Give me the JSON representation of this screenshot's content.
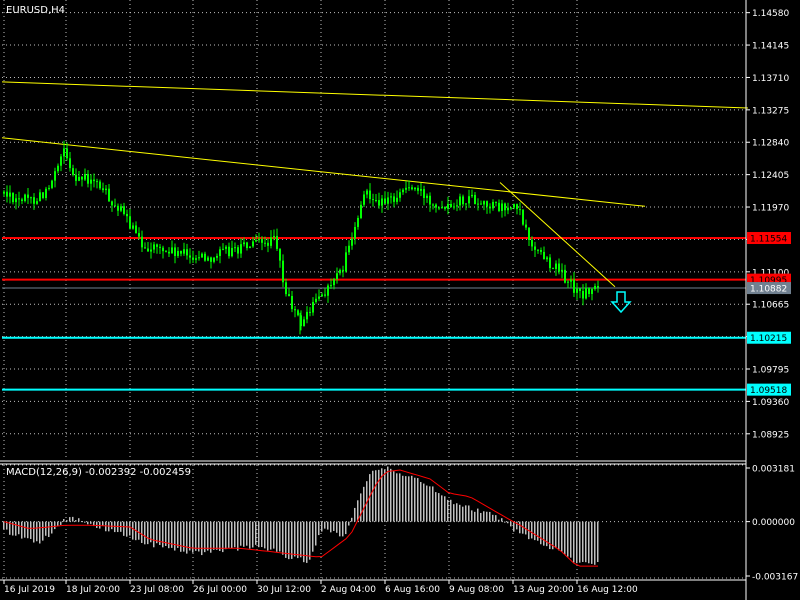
{
  "window": {
    "title": "EURUSD,H4"
  },
  "colors": {
    "background": "#000000",
    "foreground": "#ffffff",
    "grid": "#c0c0c0",
    "candle": "#00ff00",
    "trendline": "#ffff00",
    "resistance": "#ff0000",
    "support": "#00ffff",
    "bid_line": "#708090",
    "macd_hist": "#c0c0c0",
    "macd_signal": "#ff0000"
  },
  "price_axis": {
    "ticks": [
      "1.14580",
      "1.14145",
      "1.13710",
      "1.13275",
      "1.12840",
      "1.12405",
      "1.11970",
      "1.11535",
      "1.11100",
      "1.10665",
      "1.10230",
      "1.09795",
      "1.09360",
      "1.08925"
    ],
    "levels": [
      {
        "label": "1.11554",
        "kind": "resistance"
      },
      {
        "label": "1.10995",
        "kind": "resistance"
      },
      {
        "label": "1.10882",
        "kind": "bid"
      },
      {
        "label": "1.10215",
        "kind": "support"
      },
      {
        "label": "1.09518",
        "kind": "support"
      }
    ]
  },
  "time_axis": {
    "labels": [
      "16 Jul 2019",
      "18 Jul 20:00",
      "23 Jul 08:00",
      "26 Jul 00:00",
      "30 Jul 12:00",
      "2 Aug 04:00",
      "6 Aug 16:00",
      "9 Aug 08:00",
      "13 Aug 20:00",
      "16 Aug 12:00"
    ]
  },
  "macd": {
    "label": "MACD(12,26,9) -0.002392 -0.002459",
    "ticks": [
      "0.003181",
      "0.000000",
      "-0.003167"
    ]
  },
  "chart_data": [
    {
      "type": "candlestick",
      "title": "EURUSD,H4",
      "ylim": [
        1.086,
        1.1475
      ],
      "x": [
        "16 Jul 2019",
        "18 Jul 20:00",
        "23 Jul 08:00",
        "26 Jul 00:00",
        "30 Jul 12:00",
        "2 Aug 04:00",
        "6 Aug 16:00",
        "9 Aug 08:00",
        "13 Aug 20:00",
        "16 Aug 12:00"
      ],
      "close_path": [
        {
          "x": "16 Jul 2019",
          "y": 1.1215
        },
        {
          "x": "18 Jul 20:00",
          "y": 1.1265
        },
        {
          "x": "23 Jul 08:00",
          "y": 1.115
        },
        {
          "x": "26 Jul 00:00",
          "y": 1.113
        },
        {
          "x": "30 Jul 12:00",
          "y": 1.1155
        },
        {
          "x": "2 Aug 04:00",
          "y": 1.1085
        },
        {
          "x": "6 Aug 16:00",
          "y": 1.1205
        },
        {
          "x": "9 Aug 08:00",
          "y": 1.1195
        },
        {
          "x": "13 Aug 20:00",
          "y": 1.113
        },
        {
          "x": "16 Aug 12:00",
          "y": 1.1092
        }
      ],
      "low": 1.1026,
      "high": 1.1286,
      "horizontal_lines": [
        1.11554,
        1.10995,
        1.10882,
        1.10215,
        1.09518
      ],
      "trendlines": [
        {
          "from": {
            "x": "16 Jul 2019",
            "y": 1.1365
          },
          "to": {
            "x": "16 Aug 12:00",
            "y": 1.133
          }
        },
        {
          "from": {
            "x": "16 Jul 2019",
            "y": 1.129
          },
          "to": {
            "x": "16 Aug 12:00",
            "y": 1.1198
          }
        },
        {
          "from": {
            "x": "13 Aug 20:00",
            "y": 1.123
          },
          "to": {
            "x": "16 Aug 12:00",
            "y": 1.109
          }
        }
      ],
      "signal_arrow": {
        "direction": "down",
        "x": "16 Aug 12:00"
      }
    },
    {
      "type": "bar",
      "title": "MACD(12,26,9) -0.002392 -0.002459",
      "ylim": [
        -0.003167,
        0.003181
      ],
      "x": [
        "16 Jul 2019",
        "18 Jul 20:00",
        "23 Jul 08:00",
        "26 Jul 00:00",
        "30 Jul 12:00",
        "2 Aug 04:00",
        "6 Aug 16:00",
        "9 Aug 08:00",
        "13 Aug 20:00",
        "16 Aug 12:00"
      ],
      "series": [
        {
          "values": [
            -0.0005,
            0.0002,
            -0.0009,
            -0.0018,
            -0.0013,
            -0.0004,
            0.003,
            0.0012,
            -0.0004,
            -0.0024
          ]
        },
        {
          "values": [
            0.0,
            -0.0002,
            -0.0003,
            -0.0015,
            -0.0016,
            -0.002,
            0.0028,
            0.0016,
            0.0,
            -0.0025
          ]
        }
      ]
    }
  ]
}
